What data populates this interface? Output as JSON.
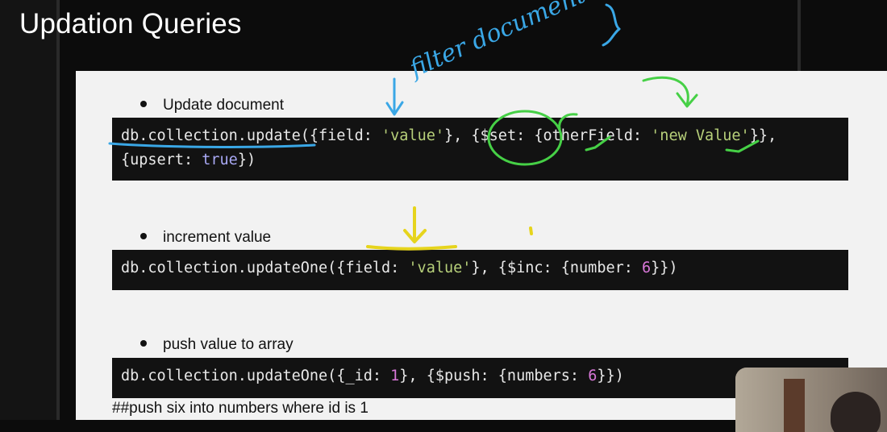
{
  "title": "Updation Queries",
  "items": [
    {
      "bullet": "Update document",
      "code": [
        [
          [
            "db.collection.update({field: ",
            ""
          ],
          [
            "'value'",
            "str"
          ],
          [
            "}, {$set: {otherField: ",
            ""
          ],
          [
            "'new Value'",
            "str"
          ],
          [
            "}},",
            ""
          ]
        ],
        [
          [
            "{upsert: ",
            ""
          ],
          [
            "true",
            "kw"
          ],
          [
            "})",
            ""
          ]
        ]
      ]
    },
    {
      "bullet": "increment value",
      "code": [
        [
          [
            "db.collection.updateOne({field: ",
            ""
          ],
          [
            "'value'",
            "str"
          ],
          [
            "}, {$inc: {number: ",
            ""
          ],
          [
            "6",
            "num"
          ],
          [
            "}})",
            ""
          ]
        ]
      ]
    },
    {
      "bullet": "push value to array",
      "code": [
        [
          [
            "db.collection.updateOne({_id: ",
            ""
          ],
          [
            "1",
            "num"
          ],
          [
            "}, {$push: {numbers: ",
            ""
          ],
          [
            "6",
            "num"
          ],
          [
            "}})",
            ""
          ]
        ]
      ]
    }
  ],
  "comment": "##push six into numbers where id is 1",
  "annotations": {
    "handwritten_note": "filter documents",
    "colors": {
      "blue": "#3aa7e6",
      "green": "#46d046",
      "yellow": "#e6d41c"
    }
  },
  "webcam": {
    "label": "presenter-webcam"
  }
}
